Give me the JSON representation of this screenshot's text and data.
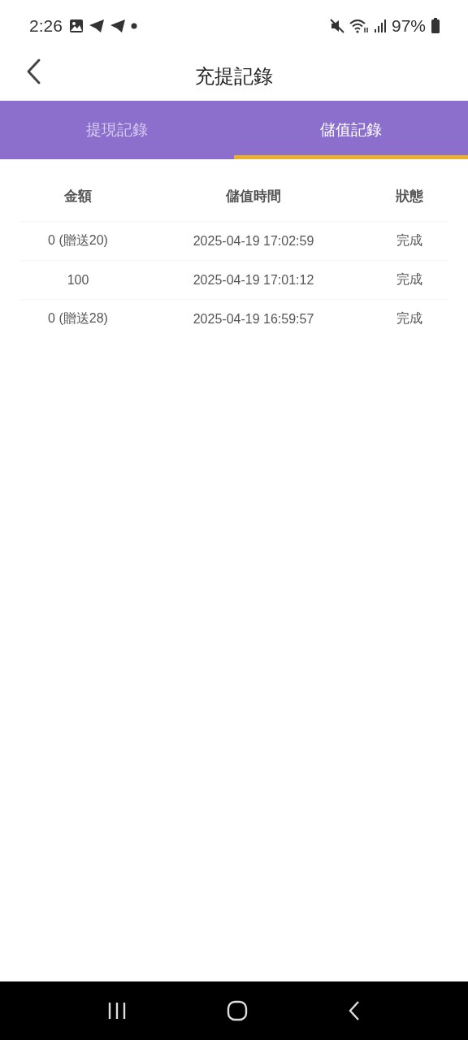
{
  "status_bar": {
    "time": "2:26",
    "battery": "97%"
  },
  "header": {
    "title": "充提記錄"
  },
  "tabs": [
    {
      "label": "提現記錄",
      "selected": false
    },
    {
      "label": "儲值記錄",
      "selected": true
    }
  ],
  "table": {
    "columns": [
      "金額",
      "儲值時間",
      "狀態"
    ],
    "rows": [
      [
        "0 (贈送20)",
        "2025-04-19 17:02:59",
        "完成"
      ],
      [
        "100",
        "2025-04-19 17:01:12",
        "完成"
      ],
      [
        "0 (贈送28)",
        "2025-04-19 16:59:57",
        "完成"
      ]
    ]
  }
}
